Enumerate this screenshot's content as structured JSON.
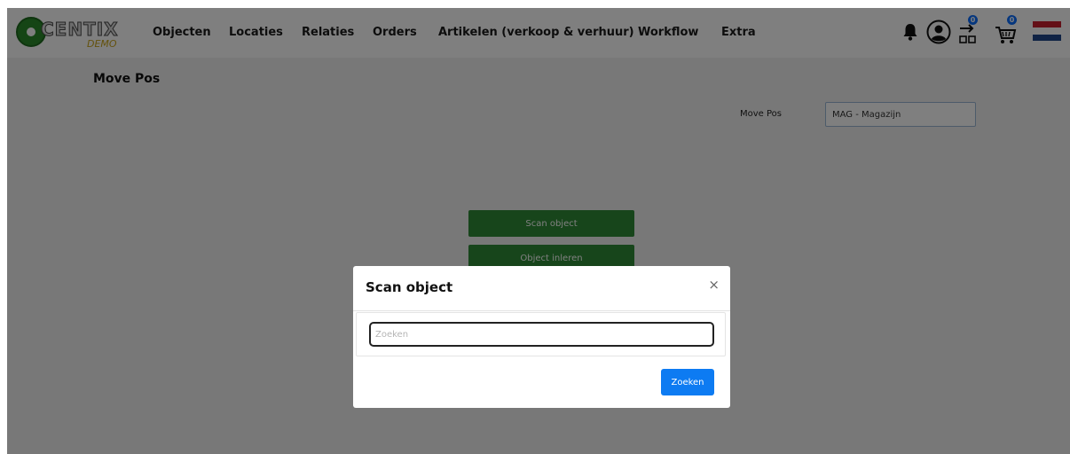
{
  "brand": {
    "logo_text": "CENTIX",
    "logo_sub": "DEMO"
  },
  "nav": {
    "items": [
      {
        "label": "Objecten"
      },
      {
        "label": "Locaties"
      },
      {
        "label": "Relaties"
      },
      {
        "label": "Orders"
      },
      {
        "label": "Artikelen (verkoop & verhuur)"
      },
      {
        "label": "Workflow"
      },
      {
        "label": "Extra"
      }
    ],
    "icons": {
      "notifications": "bell-icon",
      "user": "user-avatar-icon",
      "transfer": "transfer-basket-icon",
      "transfer_count": "0",
      "cart": "shopping-cart-icon",
      "cart_count": "0",
      "language": "dutch-flag-icon"
    }
  },
  "page": {
    "title": "Move Pos",
    "field_label": "Move Pos",
    "field_value": "MAG - Magazijn",
    "scan_button": "Scan object",
    "inleren_button": "Object inleren"
  },
  "modal": {
    "title": "Scan object",
    "close": "×",
    "search_placeholder": "Zoeken",
    "search_value": "",
    "submit_label": "Zoeken"
  },
  "colors": {
    "primary_green": "#2e8b36",
    "primary_blue": "#0d7bf2",
    "badge_blue": "#0d6efd"
  }
}
